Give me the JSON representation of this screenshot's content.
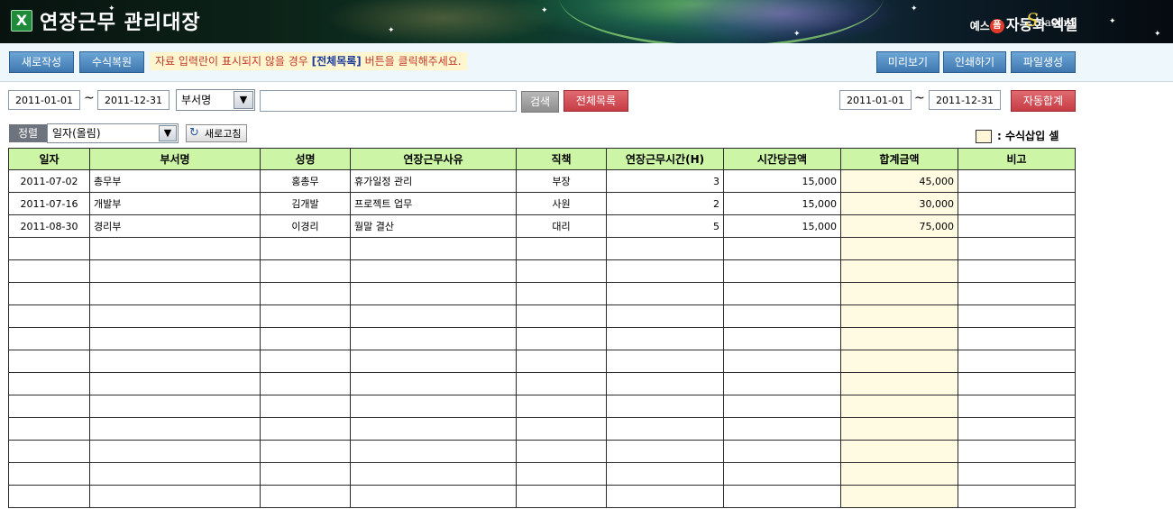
{
  "header": {
    "title": "연장근무 관리대장",
    "app_icon": "excel-icon",
    "brand_prefix": "예스",
    "brand_badge": "폼",
    "brand_name": "자동화 엑셀",
    "brand_season_s": "S",
    "brand_season_rest": "eason",
    "brand_season_num": "2"
  },
  "toolbar": {
    "new_label": "새로작성",
    "formula_restore_label": "수식복원",
    "notice_pre": "자료 입력란이 표시되지  않을 경우 ",
    "notice_bold": "[전체목록]",
    "notice_post": " 버튼을 클릭해주세요.",
    "preview_label": "미리보기",
    "print_label": "인쇄하기",
    "file_label": "파일생성"
  },
  "filter": {
    "start_date": "2011-01-01",
    "end_date": "2011-12-31",
    "tilde": "~",
    "field_select": "부서명",
    "search_value": "",
    "search_label": "검색",
    "all_list_label": "전체목록",
    "sum_start_date": "2011-01-01",
    "sum_end_date": "2011-12-31",
    "auto_sum_label": "자동합계"
  },
  "sort": {
    "label": "정렬",
    "selected": "일자(올림)",
    "refresh_label": "새로고침",
    "legend_label": ": 수식삽입 셀"
  },
  "colors": {
    "header_bg": "#ccf5a5",
    "formula_cell_bg": "#fffbe3",
    "button_blue": "#4a86bf",
    "button_red": "#d04a52"
  },
  "table": {
    "columns": [
      "일자",
      "부서명",
      "성명",
      "연장근무사유",
      "직책",
      "연장근무시간(H)",
      "시간당금액",
      "합계금액",
      "비고"
    ],
    "rows": [
      [
        "2011-07-02",
        "총무부",
        "홍총무",
        "휴가일정 관리",
        "부장",
        "3",
        "15,000",
        "45,000",
        ""
      ],
      [
        "2011-07-16",
        "개발부",
        "김개발",
        "프로젝트 업무",
        "사원",
        "2",
        "15,000",
        "30,000",
        ""
      ],
      [
        "2011-08-30",
        "경리부",
        "이경리",
        "월말 결산",
        "대리",
        "5",
        "15,000",
        "75,000",
        ""
      ],
      [
        "",
        "",
        "",
        "",
        "",
        "",
        "",
        "",
        ""
      ],
      [
        "",
        "",
        "",
        "",
        "",
        "",
        "",
        "",
        ""
      ],
      [
        "",
        "",
        "",
        "",
        "",
        "",
        "",
        "",
        ""
      ],
      [
        "",
        "",
        "",
        "",
        "",
        "",
        "",
        "",
        ""
      ],
      [
        "",
        "",
        "",
        "",
        "",
        "",
        "",
        "",
        ""
      ],
      [
        "",
        "",
        "",
        "",
        "",
        "",
        "",
        "",
        ""
      ],
      [
        "",
        "",
        "",
        "",
        "",
        "",
        "",
        "",
        ""
      ],
      [
        "",
        "",
        "",
        "",
        "",
        "",
        "",
        "",
        ""
      ],
      [
        "",
        "",
        "",
        "",
        "",
        "",
        "",
        "",
        ""
      ],
      [
        "",
        "",
        "",
        "",
        "",
        "",
        "",
        "",
        ""
      ],
      [
        "",
        "",
        "",
        "",
        "",
        "",
        "",
        "",
        ""
      ],
      [
        "",
        "",
        "",
        "",
        "",
        "",
        "",
        "",
        ""
      ]
    ]
  }
}
